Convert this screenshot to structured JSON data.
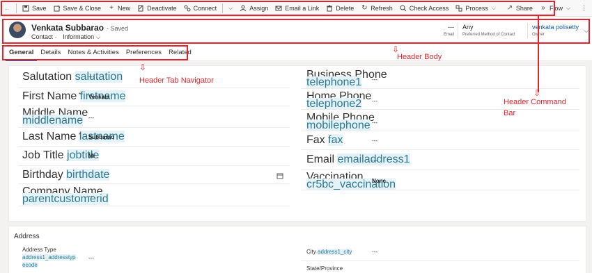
{
  "command_bar": {
    "items": [
      {
        "label": "Save",
        "icon": "save-icon"
      },
      {
        "label": "Save & Close",
        "icon": "save-close-icon"
      },
      {
        "label": "New",
        "icon": "plus-icon"
      },
      {
        "label": "Deactivate",
        "icon": "deactivate-icon"
      },
      {
        "label": "Connect",
        "icon": "connect-icon"
      },
      {
        "label": "Assign",
        "icon": "assign-icon"
      },
      {
        "label": "Email a Link",
        "icon": "email-icon"
      },
      {
        "label": "Delete",
        "icon": "delete-icon"
      },
      {
        "label": "Refresh",
        "icon": "refresh-icon"
      },
      {
        "label": "Check Access",
        "icon": "check-access-icon"
      },
      {
        "label": "Process",
        "icon": "process-icon"
      },
      {
        "label": "Share",
        "icon": "share-icon"
      },
      {
        "label": "Flow",
        "icon": "flow-icon"
      }
    ]
  },
  "header": {
    "record_name": "Venkata Subbarao",
    "save_status": "- Saved",
    "entity": "Contact",
    "separator": "·",
    "form_name": "Information",
    "email_value": "---",
    "email_label": "Email",
    "pref_value": "Any",
    "pref_label": "Preferred Method of Contact",
    "owner_value": "venkata polisetty",
    "owner_label": "Owner"
  },
  "tabs": [
    "General",
    "Details",
    "Notes & Activities",
    "Preferences",
    "Related"
  ],
  "general": {
    "left": [
      {
        "label": "Salutation",
        "tech": "salutation",
        "value": "---",
        "required": false
      },
      {
        "label": "First Name",
        "tech": "firstname",
        "value": "Venkata",
        "required": true
      },
      {
        "label": "Middle Name",
        "tech": "middlename",
        "value": "---",
        "required": false
      },
      {
        "label": "Last Name",
        "tech": "lastname",
        "value": "Subbarao",
        "required": true
      },
      {
        "label": "Job Title",
        "tech": "jobtitle",
        "value": "Mr",
        "required": false
      },
      {
        "label": "Birthday",
        "tech": "birthdate",
        "value": "---",
        "required": false
      },
      {
        "label": "Company Name",
        "tech": "parentcustomerid",
        "value": "---",
        "required": false
      }
    ],
    "right": [
      {
        "label": "Business Phone",
        "tech": "telephone1",
        "value": "---"
      },
      {
        "label": "Home Phone",
        "tech": "telephone2",
        "value": "---"
      },
      {
        "label": "Mobile Phone",
        "tech": "mobilephone",
        "value": "---"
      },
      {
        "label": "Fax",
        "tech": "fax",
        "value": "---"
      },
      {
        "label": "Email",
        "tech": "emailaddress1",
        "value": "---"
      },
      {
        "label": "Vaccination",
        "tech": "cr5bc_vaccination",
        "value": "None"
      }
    ]
  },
  "address": {
    "title": "Address",
    "address_type_label": "Address Type",
    "address_type_tech_1": "address1_addresstyp",
    "address_type_tech_2": "ecode",
    "address_type_value": "---",
    "city_label": "City",
    "city_tech": "address1_city",
    "city_value": "---",
    "state_label": "State/Province"
  },
  "annotations": {
    "header_body": "Header Body",
    "tab_navigator": "Header Tab Navigator",
    "command_bar_1": "Header Command",
    "command_bar_2": "Bar"
  },
  "colors": {
    "accent": "#0f6cbd",
    "annotation": "#e3242b",
    "owner_link": "#115ea3",
    "required": "#a4262c"
  }
}
